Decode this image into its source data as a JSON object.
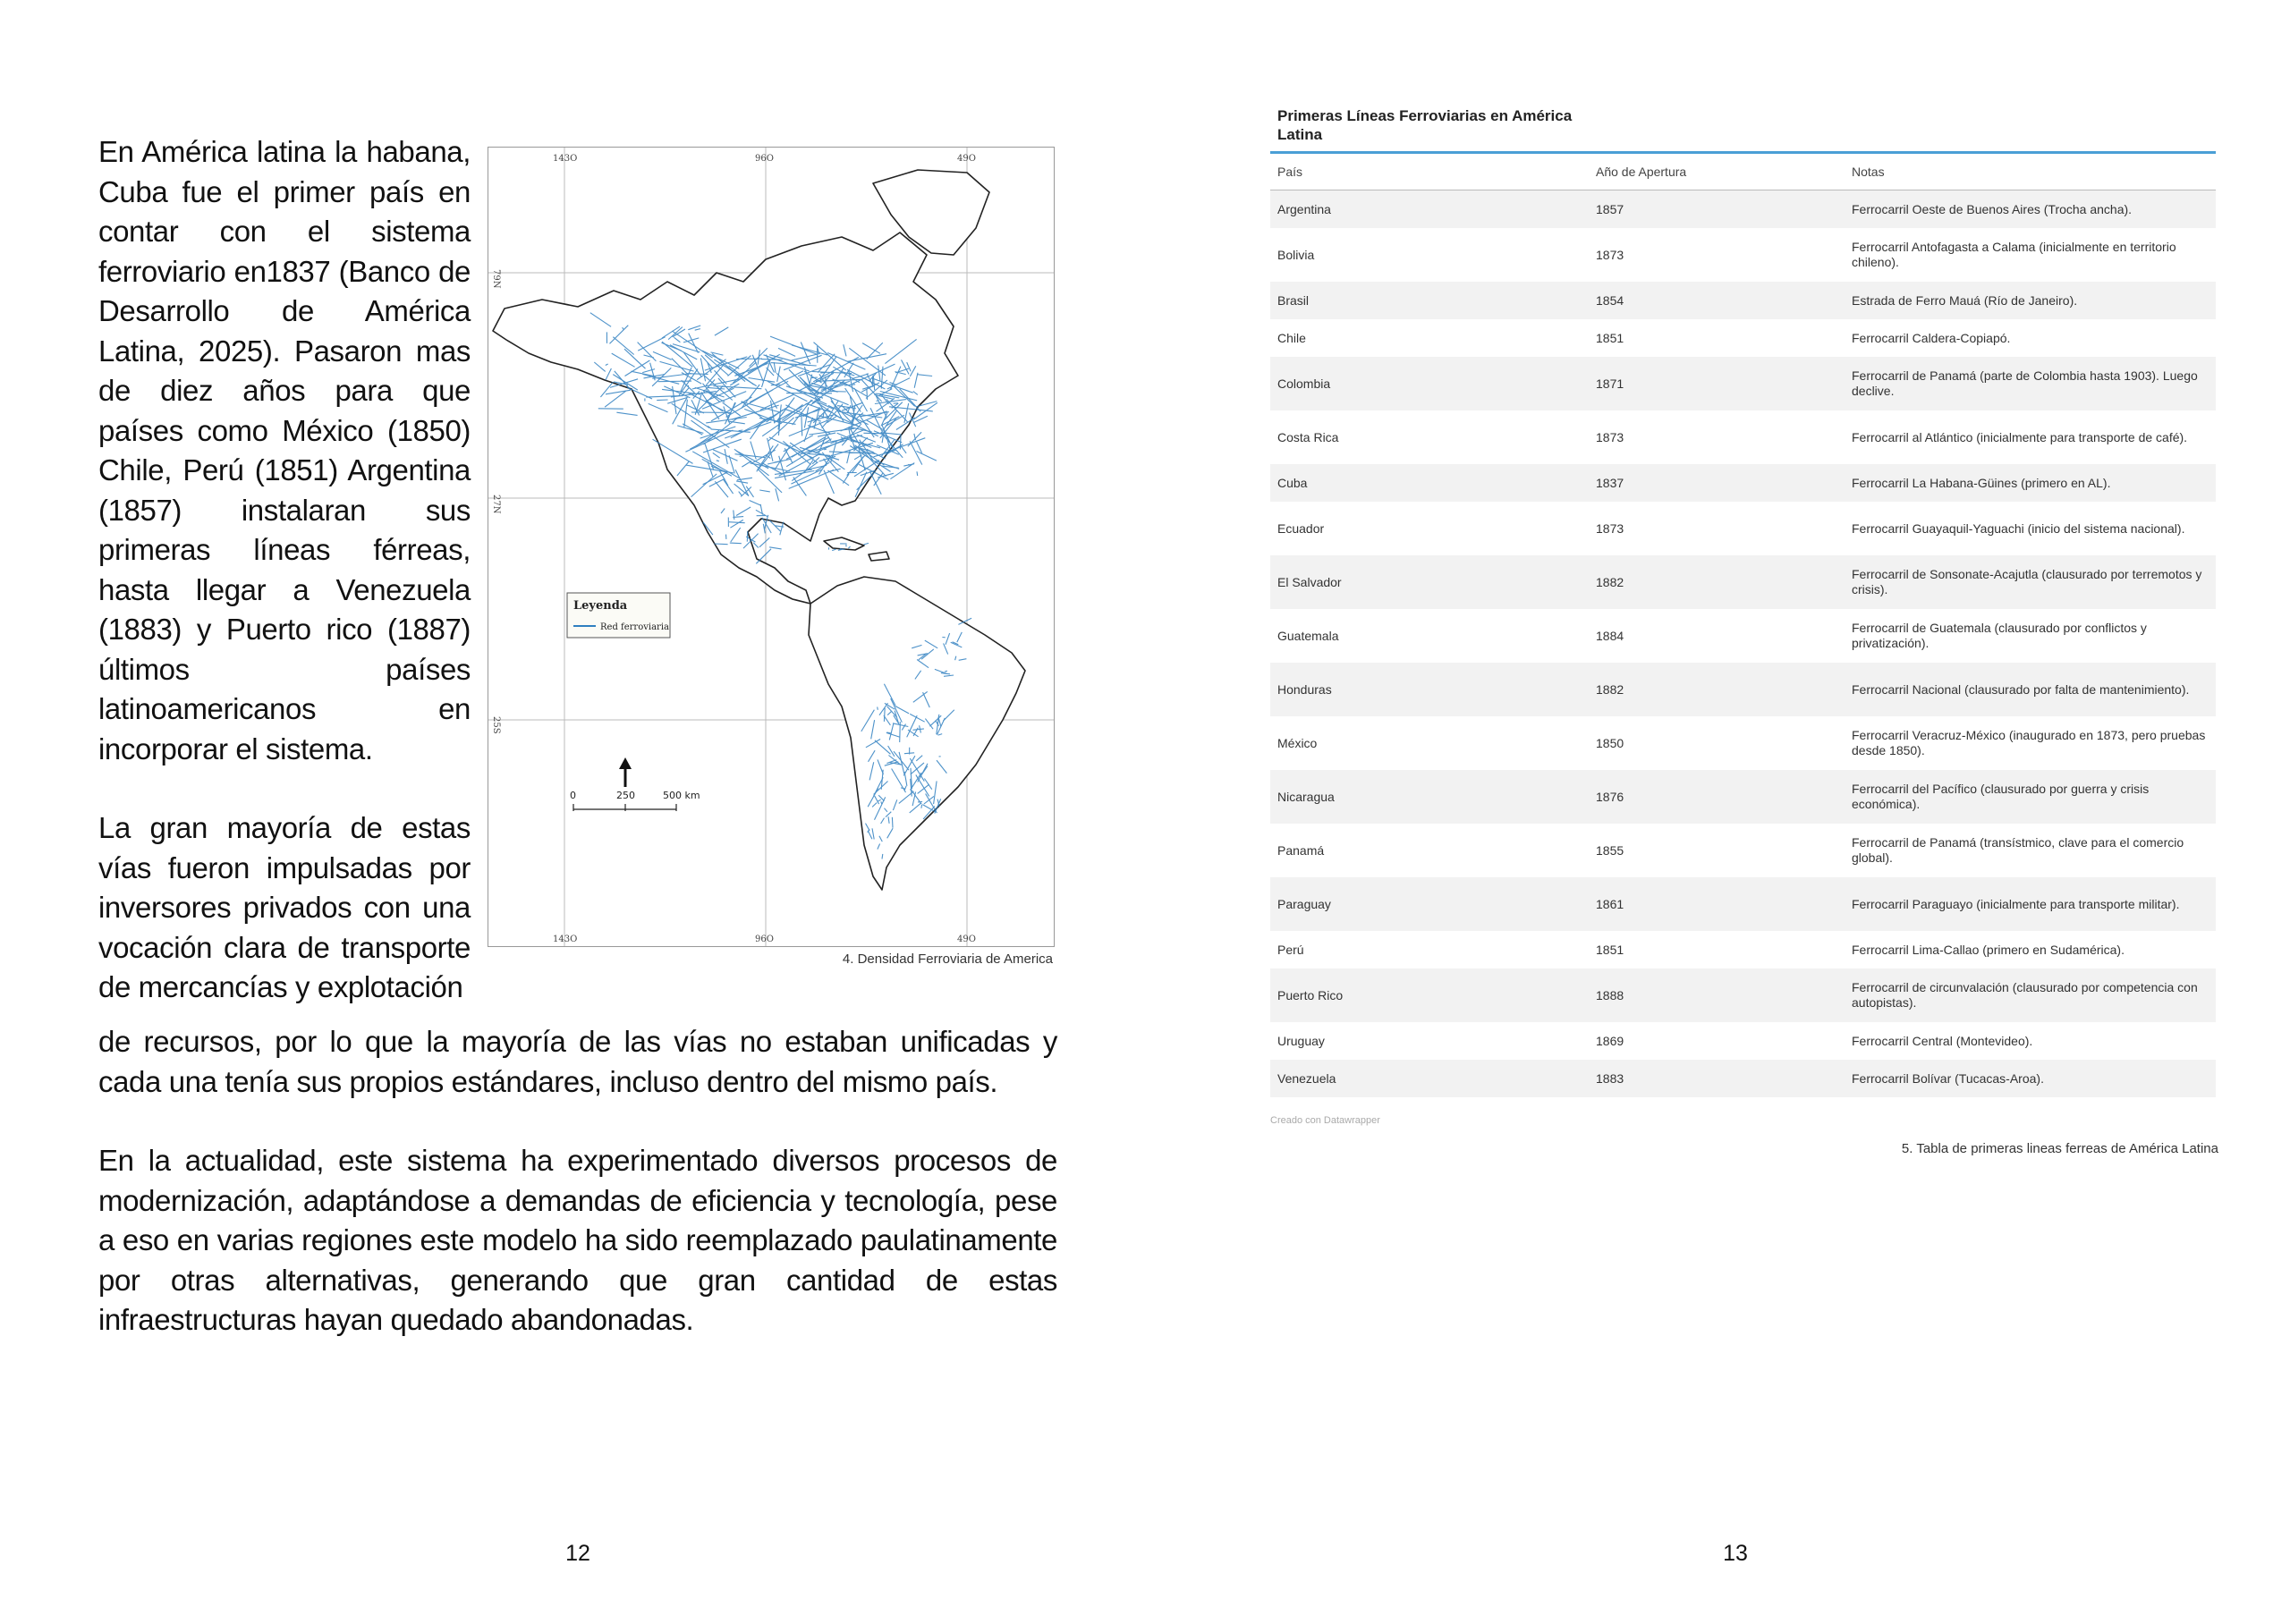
{
  "left_page": {
    "paragraph_1": "En América latina la habana, Cuba fue el primer país en contar con el sistema ferroviario en1837 (Banco de Desarrollo de América Latina, 2025). Pasaron mas de diez años para que países como México (1850) Chile, Perú (1851) Argentina (1857) instalaran sus primeras líneas férreas, hasta llegar a Venezuela (1883) y Puerto rico (1887) últimos países latinoamericanos en incorporar el sistema.",
    "paragraph_2": "La gran mayoría de estas vías fueron impulsadas por inversores privados con una vocación clara de transporte de mercancías y explotación",
    "paragraph_3": "de recursos, por lo que la mayoría de las vías no estaban unificadas y cada una tenía sus propios estándares, incluso dentro del mismo país.",
    "paragraph_4": "En la actualidad, este sistema ha experimentado diversos procesos de modernización, adaptándose a demandas de eficiencia y tecnología, pese a eso en varias regiones este modelo ha sido reemplazado paulatinamente por otras alternativas, generando que gran cantidad de estas infraestructuras hayan quedado abandonadas.",
    "page_number": "12",
    "map": {
      "top_labels": [
        "143O",
        "96O",
        "49O"
      ],
      "bottom_labels": [
        "143O",
        "96O",
        "49O"
      ],
      "lat_labels": [
        "79N",
        "27N",
        "25S"
      ],
      "legend_title": "Leyenda",
      "legend_item": "Red ferroviaria",
      "scale_labels": [
        "0",
        "250",
        "500 km"
      ],
      "caption": "4. Densidad Ferroviaria  de America",
      "line_color": "#2f7fc0"
    }
  },
  "right_page": {
    "page_number": "13",
    "table": {
      "title": "Primeras Líneas Ferroviarias en América Latina",
      "headers": [
        "País",
        "Año de Apertura",
        "Notas"
      ],
      "rows": [
        [
          "Argentina",
          "1857",
          "Ferrocarril Oeste de Buenos Aires (Trocha ancha)."
        ],
        [
          "Bolivia",
          "1873",
          "Ferrocarril Antofagasta a Calama (inicialmente en territorio chileno)."
        ],
        [
          "Brasil",
          "1854",
          "Estrada de Ferro Mauá (Río de Janeiro)."
        ],
        [
          "Chile",
          "1851",
          "Ferrocarril Caldera-Copiapó."
        ],
        [
          "Colombia",
          "1871",
          "Ferrocarril de Panamá (parte de Colombia hasta 1903). Luego declive."
        ],
        [
          "Costa Rica",
          "1873",
          "Ferrocarril al Atlántico (inicialmente para transporte de café)."
        ],
        [
          "Cuba",
          "1837",
          "Ferrocarril La Habana-Güines (primero en AL)."
        ],
        [
          "Ecuador",
          "1873",
          "Ferrocarril Guayaquil-Yaguachi (inicio del sistema nacional)."
        ],
        [
          "El Salvador",
          "1882",
          "Ferrocarril de Sonsonate-Acajutla (clausurado por terremotos y crisis)."
        ],
        [
          "Guatemala",
          "1884",
          "Ferrocarril de Guatemala (clausurado por conflictos y privatización)."
        ],
        [
          "Honduras",
          "1882",
          "Ferrocarril Nacional (clausurado por falta de mantenimiento)."
        ],
        [
          "México",
          "1850",
          "Ferrocarril Veracruz-México (inaugurado en 1873, pero pruebas desde 1850)."
        ],
        [
          "Nicaragua",
          "1876",
          "Ferrocarril del Pacífico (clausurado por guerra y crisis económica)."
        ],
        [
          "Panamá",
          "1855",
          "Ferrocarril de Panamá (transístmico, clave para el comercio global)."
        ],
        [
          "Paraguay",
          "1861",
          "Ferrocarril Paraguayo (inicialmente para transporte militar)."
        ],
        [
          "Perú",
          "1851",
          "Ferrocarril Lima-Callao (primero en Sudamérica)."
        ],
        [
          "Puerto Rico",
          "1888",
          "Ferrocarril de circunvalación (clausurado por competencia con autopistas)."
        ],
        [
          "Uruguay",
          "1869",
          "Ferrocarril Central (Montevideo)."
        ],
        [
          "Venezuela",
          "1883",
          "Ferrocarril Bolívar (Tucacas-Aroa)."
        ]
      ],
      "credit": "Creado con Datawrapper",
      "caption": "5. Tabla de primeras lineas ferreas de América Latina",
      "accent_color": "#4a9fd6"
    }
  }
}
